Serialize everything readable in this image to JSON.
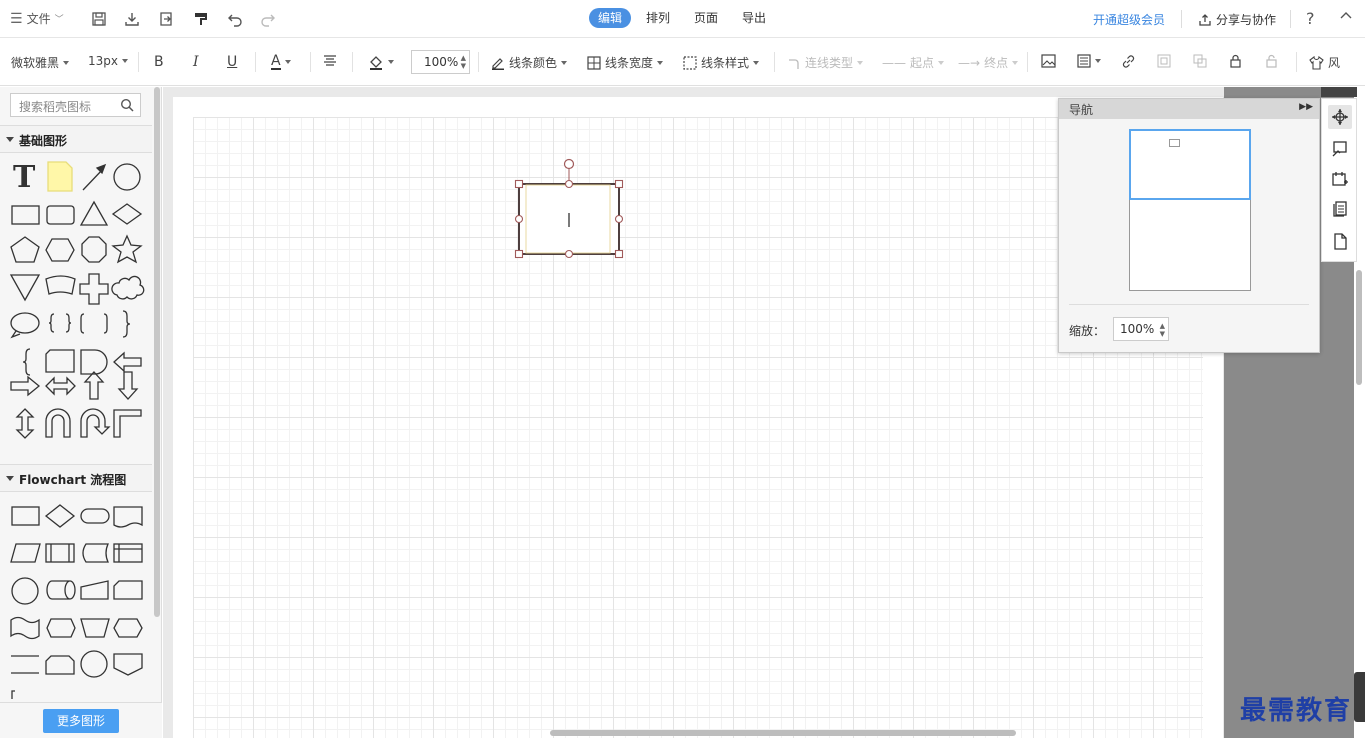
{
  "topbar": {
    "file_label": "文件",
    "tabs": [
      {
        "label": "编辑",
        "active": true
      },
      {
        "label": "排列",
        "active": false
      },
      {
        "label": "页面",
        "active": false
      },
      {
        "label": "导出",
        "active": false
      }
    ],
    "vip_label": "开通超级会员",
    "share_label": "分享与协作",
    "help_label": "?",
    "accent_color": "#4a90e2"
  },
  "format_toolbar": {
    "font_family": "微软雅黑",
    "font_size": "13px",
    "bold": "B",
    "italic": "I",
    "underline": "U",
    "font_color": "A",
    "zoom": "100%",
    "line_color": "线条颜色",
    "line_width": "线条宽度",
    "line_style": "线条样式",
    "connector_type": "连线类型",
    "start_point": "起点",
    "end_point": "终点",
    "more": "风"
  },
  "left_panel": {
    "search_placeholder": "搜索稻壳图标",
    "section_basic": "基础图形",
    "section_flowchart": "Flowchart 流程图",
    "more_shapes": "更多图形"
  },
  "nav_panel": {
    "title": "导航",
    "zoom_label": "缩放：",
    "zoom_value": "100%"
  },
  "watermark": "最需教育"
}
